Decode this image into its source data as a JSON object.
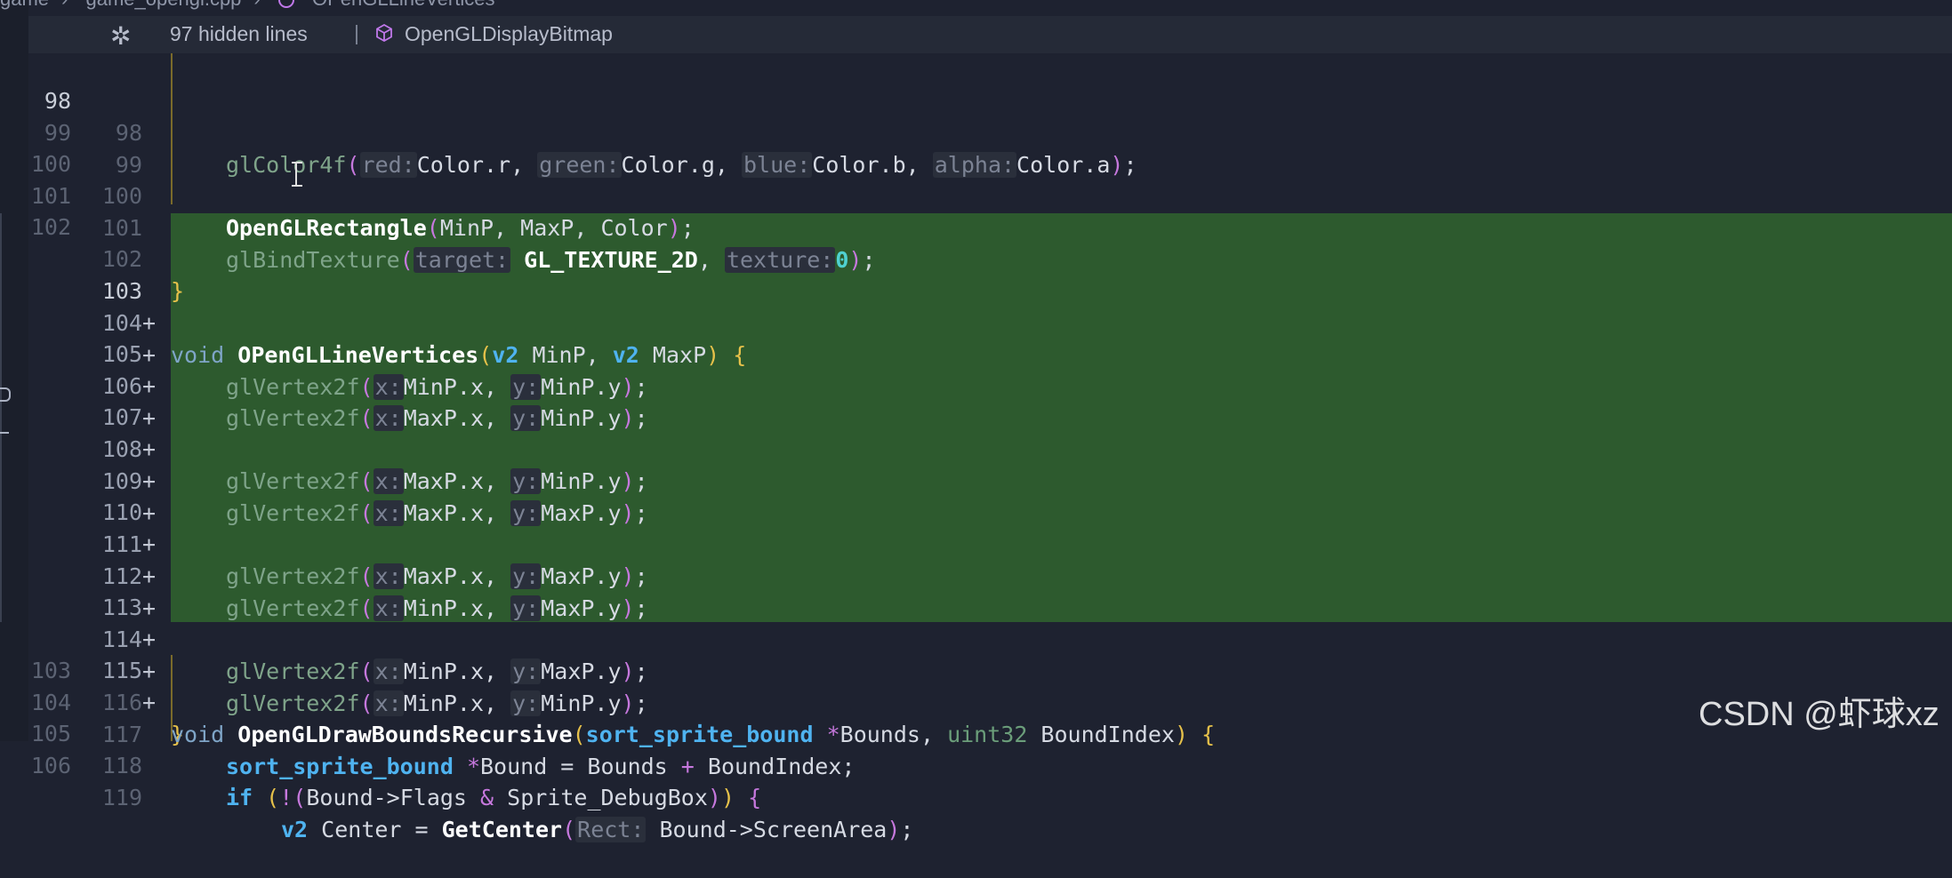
{
  "breadcrumb": {
    "items": [
      "game",
      "game_opengl.cpp",
      "OPenGLLineVertices"
    ]
  },
  "hidden_bar": {
    "text": "97 hidden lines",
    "separator": "|",
    "symbol": "OpenGLDisplayBitmap",
    "fold_icon": "fold-icon",
    "symbol_icon": "cube-icon"
  },
  "lines": [
    {
      "old": "98",
      "new": "98",
      "mark": ""
    },
    {
      "old": "99",
      "new": "99",
      "mark": ""
    },
    {
      "old": "100",
      "new": "100",
      "mark": ""
    },
    {
      "old": "101",
      "new": "101",
      "mark": ""
    },
    {
      "old": "102",
      "new": "102",
      "mark": ""
    },
    {
      "old": "",
      "new": "103",
      "mark": "+"
    },
    {
      "old": "",
      "new": "104",
      "mark": "+"
    },
    {
      "old": "",
      "new": "105",
      "mark": "+"
    },
    {
      "old": "",
      "new": "106",
      "mark": "+"
    },
    {
      "old": "",
      "new": "107",
      "mark": "+"
    },
    {
      "old": "",
      "new": "108",
      "mark": "+"
    },
    {
      "old": "",
      "new": "109",
      "mark": "+"
    },
    {
      "old": "",
      "new": "110",
      "mark": "+"
    },
    {
      "old": "",
      "new": "111",
      "mark": "+"
    },
    {
      "old": "",
      "new": "112",
      "mark": "+"
    },
    {
      "old": "",
      "new": "113",
      "mark": "+"
    },
    {
      "old": "",
      "new": "114",
      "mark": "+"
    },
    {
      "old": "",
      "new": "115",
      "mark": "+"
    },
    {
      "old": "103",
      "new": "116",
      "mark": ""
    },
    {
      "old": "104",
      "new": "117",
      "mark": ""
    },
    {
      "old": "105",
      "new": "118",
      "mark": ""
    },
    {
      "old": "106",
      "new": "119",
      "mark": ""
    }
  ],
  "tokens": {
    "glColor4f": "glColor4f",
    "red_hint": "red:",
    "green_hint": "green:",
    "blue_hint": "blue:",
    "alpha_hint": "alpha:",
    "color_r": "Color.r",
    "color_g": "Color.g",
    "color_b": "Color.b",
    "color_a": "Color.a",
    "OpenGLRectangle": "OpenGLRectangle",
    "rect_args": "MinP, MaxP, Color",
    "glBindTexture": "glBindTexture",
    "target_hint": "target:",
    "gl_texture_2d": "GL_TEXTURE_2D",
    "texture_hint": "texture:",
    "zero": "0",
    "void": "void",
    "v2": "v2",
    "OPenGLLineVertices": "OPenGLLineVertices",
    "minp_param": " MinP, ",
    "maxp_param": " MaxP",
    "glVertex2f": "glVertex2f",
    "x_hint": "x:",
    "y_hint": "y:",
    "minp_x": "MinP.x",
    "minp_y": "MinP.y",
    "maxp_x": "MaxP.x",
    "maxp_y": "MaxP.y",
    "OpenGLDrawBoundsRecursive": "OpenGLDrawBoundsRecursive",
    "sort_sprite_bound": "sort_sprite_bound",
    "bounds_param": "Bounds, ",
    "uint32": "uint32",
    "boundindex_param": " BoundIndex",
    "bound_decl": "Bound = Bounds ",
    "boundindex": " BoundIndex;",
    "if_kw": "if",
    "bound_flags": "Bound->Flags ",
    "sprite_debugbox": " Sprite_DebugBox",
    "center_decl": " Center = ",
    "GetCenter": "GetCenter",
    "rect_hint": "Rect:",
    "screenarea": "Bound->ScreenArea"
  },
  "watermark": "CSDN @虾球xz"
}
